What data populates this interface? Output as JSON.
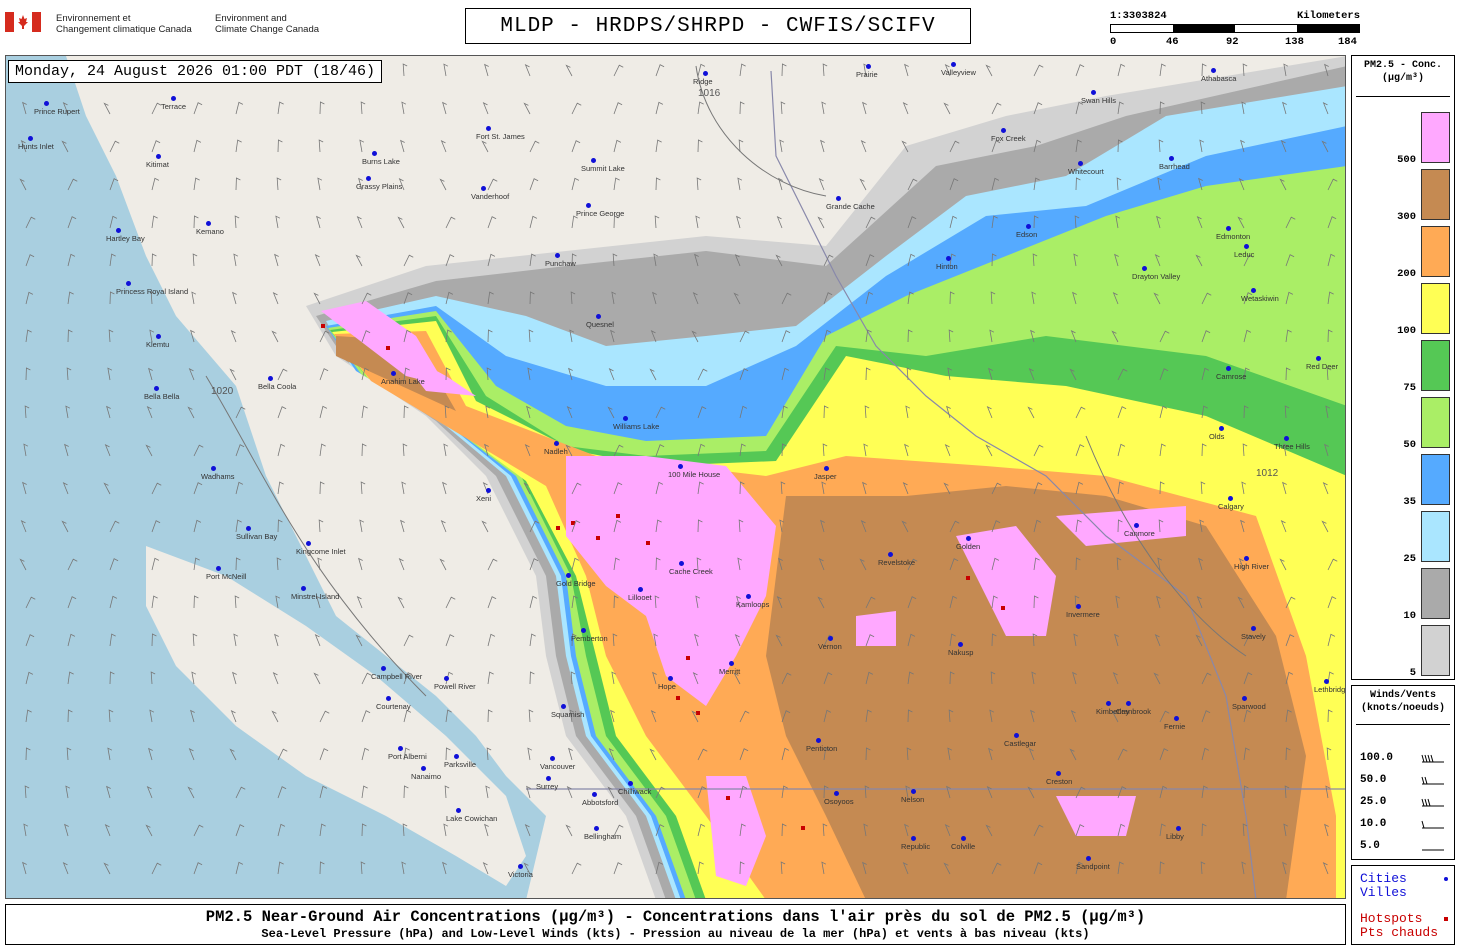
{
  "header": {
    "logo_icon": "canada-flag-icon",
    "org_fr": "Environnement et\nChangement climatique Canada",
    "org_en": "Environment and\nClimate Change Canada",
    "title": "MLDP - HRDPS/SHRPD - CWFIS/SCIFV",
    "scale_ratio": "1:3303824",
    "scale_unit": "Kilometers",
    "scale_ticks": [
      "0",
      "46",
      "92",
      "138",
      "184"
    ]
  },
  "map": {
    "timestamp": "Monday, 24 August 2026 01:00 PDT (18/46)",
    "isobar_labels": [
      "1016",
      "1020",
      "1012"
    ],
    "cities": [
      {
        "name": "Prince Rupert"
      },
      {
        "name": "Terrace"
      },
      {
        "name": "Hunts Inlet"
      },
      {
        "name": "Kitimat"
      },
      {
        "name": "Kemano"
      },
      {
        "name": "Hartley Bay"
      },
      {
        "name": "Princess Royal Island"
      },
      {
        "name": "Klemtu"
      },
      {
        "name": "Bella Bella"
      },
      {
        "name": "Bella Coola"
      },
      {
        "name": "Wadhams"
      },
      {
        "name": "Port McNeill"
      },
      {
        "name": "Sullivan Bay"
      },
      {
        "name": "Kingcome Inlet"
      },
      {
        "name": "Minstrel Island"
      },
      {
        "name": "Campbell River"
      },
      {
        "name": "Courtenay"
      },
      {
        "name": "Port Alberni"
      },
      {
        "name": "Nanaimo"
      },
      {
        "name": "Parksville"
      },
      {
        "name": "Lake Cowichan"
      },
      {
        "name": "Victoria"
      },
      {
        "name": "Vancouver"
      },
      {
        "name": "Surrey"
      },
      {
        "name": "Abbotsford"
      },
      {
        "name": "Chilliwack"
      },
      {
        "name": "Bellingham"
      },
      {
        "name": "Squamish"
      },
      {
        "name": "Powell River"
      },
      {
        "name": "Pemberton"
      },
      {
        "name": "Gold Bridge"
      },
      {
        "name": "Lillooet"
      },
      {
        "name": "Cache Creek"
      },
      {
        "name": "Kamloops"
      },
      {
        "name": "Merritt"
      },
      {
        "name": "Hope"
      },
      {
        "name": "100 Mile House"
      },
      {
        "name": "Williams Lake"
      },
      {
        "name": "Quesnel"
      },
      {
        "name": "Anahim Lake"
      },
      {
        "name": "Punchaw"
      },
      {
        "name": "Prince George"
      },
      {
        "name": "Vanderhoof"
      },
      {
        "name": "Fort St. James"
      },
      {
        "name": "Burns Lake"
      },
      {
        "name": "Grassy Plains"
      },
      {
        "name": "Summit Lake"
      },
      {
        "name": "Nadleh"
      },
      {
        "name": "Xeni"
      },
      {
        "name": "Grande Cache"
      },
      {
        "name": "Hinton"
      },
      {
        "name": "Edson"
      },
      {
        "name": "Fox Creek"
      },
      {
        "name": "Whitecourt"
      },
      {
        "name": "Valleyview"
      },
      {
        "name": "Swan Hills"
      },
      {
        "name": "Athabasca"
      },
      {
        "name": "Barrhead"
      },
      {
        "name": "Edmonton"
      },
      {
        "name": "Drayton Valley"
      },
      {
        "name": "Leduc"
      },
      {
        "name": "Wetaskiwin"
      },
      {
        "name": "Camrose"
      },
      {
        "name": "Red Deer"
      },
      {
        "name": "Olds"
      },
      {
        "name": "Three Hills"
      },
      {
        "name": "Calgary"
      },
      {
        "name": "Canmore"
      },
      {
        "name": "High River"
      },
      {
        "name": "Stavely"
      },
      {
        "name": "Revelstoke"
      },
      {
        "name": "Golden"
      },
      {
        "name": "Invermere"
      },
      {
        "name": "Vernon"
      },
      {
        "name": "Nakusp"
      },
      {
        "name": "Penticton"
      },
      {
        "name": "Osoyoos"
      },
      {
        "name": "Nelson"
      },
      {
        "name": "Castlegar"
      },
      {
        "name": "Kimberley"
      },
      {
        "name": "Cranbrook"
      },
      {
        "name": "Fernie"
      },
      {
        "name": "Creston"
      },
      {
        "name": "Colville"
      },
      {
        "name": "Republic"
      },
      {
        "name": "Libby"
      },
      {
        "name": "Sandpoint"
      },
      {
        "name": "Lethbridge"
      },
      {
        "name": "Sparwood"
      },
      {
        "name": "Ridge"
      },
      {
        "name": "Prairie"
      },
      {
        "name": "Jasper"
      }
    ]
  },
  "legend": {
    "conc_title": "PM2.5 - Conc.\n(µg/m³)",
    "levels": [
      {
        "label": "500",
        "color": "#ffa8ff"
      },
      {
        "label": "300",
        "color": "#c58a52"
      },
      {
        "label": "200",
        "color": "#ffaa55"
      },
      {
        "label": "100",
        "color": "#ffff55"
      },
      {
        "label": "75",
        "color": "#55c855"
      },
      {
        "label": "50",
        "color": "#aaee66"
      },
      {
        "label": "35",
        "color": "#55aaff"
      },
      {
        "label": "25",
        "color": "#aae6ff"
      },
      {
        "label": "10",
        "color": "#aaaaaa"
      },
      {
        "label": "5",
        "color": "#d2d2d2"
      }
    ],
    "wind_title": "Winds/Vents\n(knots/noeuds)",
    "wind_levels": [
      "100.0",
      "50.0",
      "25.0",
      "10.0",
      "5.0"
    ],
    "cities_label": "Cities\nVilles",
    "hotspots_label": "Hotspots\nPts chauds",
    "city_color": "#1010d8",
    "hotspot_color": "#c80000"
  },
  "footer": {
    "line1": "PM2.5 Near-Ground Air Concentrations (µg/m³) - Concentrations dans l'air près du sol de PM2.5 (µg/m³)",
    "line2": "Sea-Level Pressure (hPa) and Low-Level Winds (kts) - Pression au niveau de la mer (hPa) et vents à bas niveau (kts)"
  }
}
